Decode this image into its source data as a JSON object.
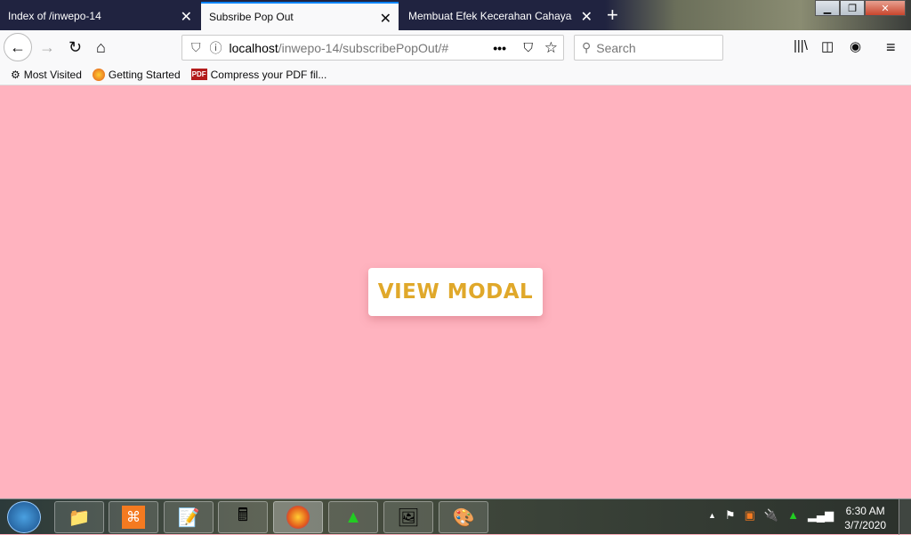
{
  "browser": {
    "tabs": [
      {
        "label": "Index of /inwepo-14",
        "active": false
      },
      {
        "label": "Subsribe Pop Out",
        "active": true
      },
      {
        "label": "Membuat Efek Kecerahan Cahaya",
        "active": false
      }
    ],
    "url_host": "localhost",
    "url_path": "/inwepo-14/subscribePopOut/#",
    "search_placeholder": "Search",
    "bookmarks": [
      {
        "label": "Most Visited"
      },
      {
        "label": "Getting Started"
      },
      {
        "label": "Compress your PDF fil..."
      }
    ],
    "pdf_badge": "PDF"
  },
  "page": {
    "button_label": "VIEW MODAL",
    "background": "#ffb3bf",
    "accent": "#e0a82a"
  },
  "taskbar": {
    "time": "6:30 AM",
    "date": "3/7/2020"
  }
}
